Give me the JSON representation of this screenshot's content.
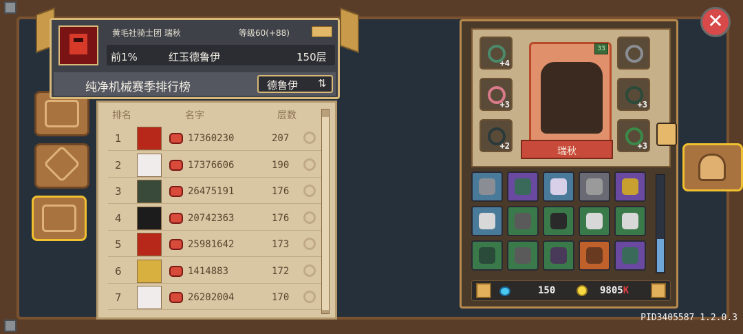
{
  "header": {
    "guild": "黄毛社骑士团 瑞秋",
    "level": "等级60(+88)",
    "percentile": "前1%",
    "character": "红玉德鲁伊",
    "floors": "150层",
    "leaderboard_title": "纯净机械赛季排行榜",
    "class_switch_label": "德鲁伊",
    "switch_glyph": "⇅"
  },
  "list": {
    "columns": {
      "rank": "排名",
      "name": "名字",
      "floors": "层数"
    },
    "rows": [
      {
        "rank": "1",
        "name": "17360230",
        "floors": "207",
        "pet_color": "#b8281a"
      },
      {
        "rank": "2",
        "name": "17376606",
        "floors": "190",
        "pet_color": "#f0ecec"
      },
      {
        "rank": "3",
        "name": "26475191",
        "floors": "176",
        "pet_color": "#3a4a3a"
      },
      {
        "rank": "4",
        "name": "20742363",
        "floors": "176",
        "pet_color": "#1c1c1c"
      },
      {
        "rank": "5",
        "name": "25981642",
        "floors": "173",
        "pet_color": "#b8281a"
      },
      {
        "rank": "6",
        "name": "1414883",
        "floors": "172",
        "pet_color": "#d8b040"
      },
      {
        "rank": "7",
        "name": "26202004",
        "floors": "170",
        "pet_color": "#f0ecec"
      }
    ]
  },
  "equipment": {
    "character_name": "瑞秋",
    "level_tag": "33",
    "slot_plus": [
      "+4",
      "+3",
      "+2",
      "",
      "+3",
      "+3"
    ]
  },
  "inventory": {
    "cells": [
      {
        "bg": "#4a7a9a",
        "icon": "#8a8e94"
      },
      {
        "bg": "#6a4aa0",
        "icon": "#3a6a5a"
      },
      {
        "bg": "#4a7a9a",
        "icon": "#d8d0e8"
      },
      {
        "bg": "#6a6a74",
        "icon": "#9a9a9a"
      },
      {
        "bg": "#6a4aa0",
        "icon": "#c8a030"
      },
      {
        "bg": "#4a7a9a",
        "icon": "#d8d8d8"
      },
      {
        "bg": "#3a7a4a",
        "icon": "#5a5a5a"
      },
      {
        "bg": "#3a7a4a",
        "icon": "#2a2a2a"
      },
      {
        "bg": "#3a7a4a",
        "icon": "#d8d8d8"
      },
      {
        "bg": "#3a7a4a",
        "icon": "#d8d8d8"
      },
      {
        "bg": "#3a7a4a",
        "icon": "#2a4a3a"
      },
      {
        "bg": "#3a7a4a",
        "icon": "#5a5a5a"
      },
      {
        "bg": "#3a7a4a",
        "icon": "#4a3a5a"
      },
      {
        "bg": "#c0602a",
        "icon": "#6a3a20"
      },
      {
        "bg": "#6a4aa0",
        "icon": "#3a6a5a"
      }
    ]
  },
  "currency": {
    "gems": "150",
    "coins_value": "9805",
    "coins_suffix": "K"
  },
  "close_glyph": "✕",
  "version": "PID3405587 1.2.0.3"
}
